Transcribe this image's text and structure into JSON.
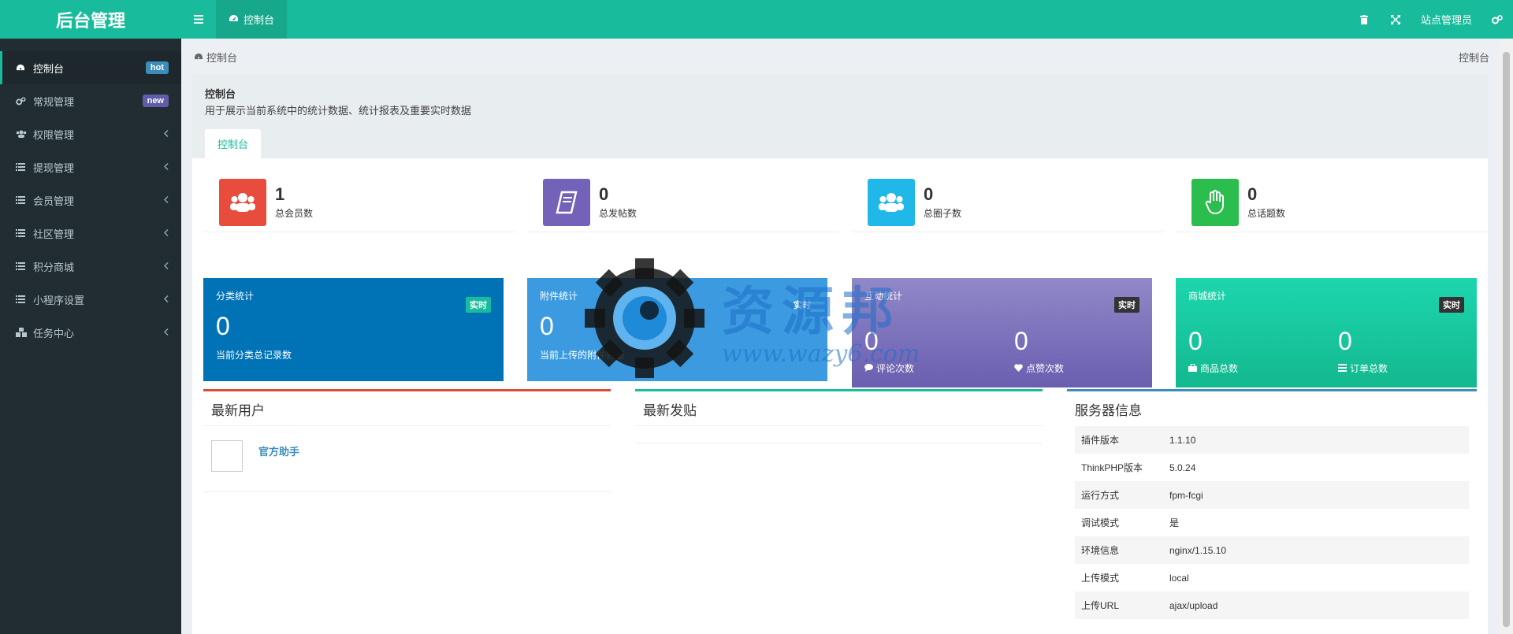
{
  "app": {
    "logo": "后台管理"
  },
  "topbar": {
    "tab_label": "控制台",
    "user_label": "站点管理员"
  },
  "sidebar": {
    "items": [
      {
        "label": "控制台",
        "icon": "dashboard-icon",
        "badge": "hot",
        "badge_color": "#3c8dbc",
        "active": true
      },
      {
        "label": "常规管理",
        "icon": "cogs-icon",
        "badge": "new",
        "badge_color": "#605ca8"
      },
      {
        "label": "权限管理",
        "icon": "group-icon"
      },
      {
        "label": "提现管理",
        "icon": "list-icon"
      },
      {
        "label": "会员管理",
        "icon": "list-icon"
      },
      {
        "label": "社区管理",
        "icon": "list-icon"
      },
      {
        "label": "积分商城",
        "icon": "list-icon"
      },
      {
        "label": "小程序设置",
        "icon": "list-icon"
      },
      {
        "label": "任务中心",
        "icon": "cubes-icon"
      }
    ]
  },
  "breadcrumb": {
    "label": "控制台",
    "right": "控制台"
  },
  "panel": {
    "title": "控制台",
    "description": "用于展示当前系统中的统计数据、统计报表及重要实时数据",
    "tab": "控制台"
  },
  "stats": [
    {
      "value": "1",
      "label": "总会员数",
      "color": "#e74c3c",
      "icon": "users-icon"
    },
    {
      "value": "0",
      "label": "总发帖数",
      "color": "#7462b8",
      "icon": "book-icon"
    },
    {
      "value": "0",
      "label": "总圈子数",
      "color": "#20b8e8",
      "icon": "users-icon"
    },
    {
      "value": "0",
      "label": "总话题数",
      "color": "#2bbd4d",
      "icon": "hand-icon"
    }
  ],
  "cards": {
    "category": {
      "title": "分类统计",
      "tag": "实时",
      "value": "0",
      "sub": "当前分类总记录数"
    },
    "attachment": {
      "title": "附件统计",
      "tag": "实时",
      "value": "0",
      "sub": "当前上传的附件数量"
    },
    "interaction": {
      "title": "互动统计",
      "tag": "实时",
      "a_value": "0",
      "a_label": "评论次数",
      "b_value": "0",
      "b_label": "点赞次数"
    },
    "mall": {
      "title": "商城统计",
      "tag": "实时",
      "a_value": "0",
      "a_label": "商品总数",
      "b_value": "0",
      "b_label": "订单总数"
    }
  },
  "latest_users": {
    "title": "最新用户",
    "users": [
      {
        "name": "官方助手"
      }
    ]
  },
  "latest_posts": {
    "title": "最新发贴"
  },
  "server": {
    "title": "服务器信息",
    "rows": [
      {
        "k": "插件版本",
        "v": "1.1.10"
      },
      {
        "k": "ThinkPHP版本",
        "v": "5.0.24"
      },
      {
        "k": "运行方式",
        "v": "fpm-fcgi"
      },
      {
        "k": "调试模式",
        "v": "是"
      },
      {
        "k": "环境信息",
        "v": "nginx/1.15.10"
      },
      {
        "k": "上传模式",
        "v": "local"
      },
      {
        "k": "上传URL",
        "v": "ajax/upload"
      }
    ]
  },
  "watermark": {
    "text": "资源邦",
    "url": "www.wazy6.com"
  }
}
